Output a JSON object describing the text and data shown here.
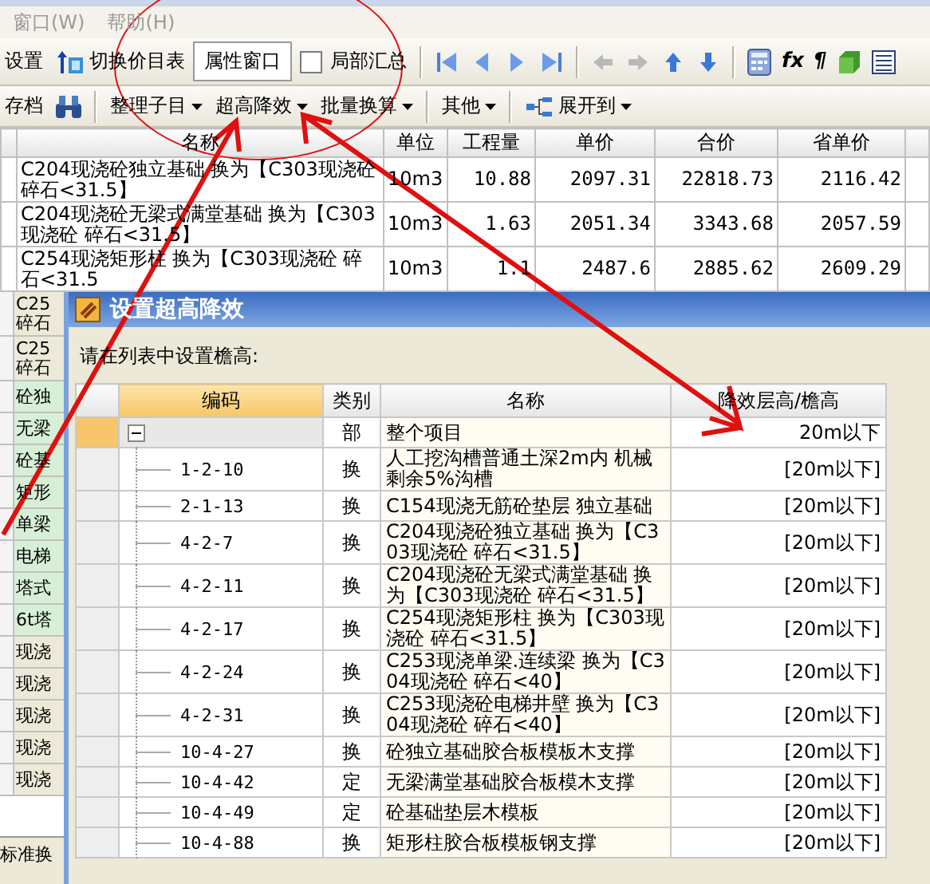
{
  "menu": [
    {
      "label": "窗口(W)",
      "disabled": true
    },
    {
      "label": "帮助(H)",
      "disabled": true
    }
  ],
  "toolbar": {
    "items": [
      {
        "kind": "button",
        "label": "设置"
      },
      {
        "kind": "icon-button",
        "label": "切换价目表"
      },
      {
        "kind": "toggle",
        "label": "属性窗口",
        "selected": true
      },
      {
        "kind": "checkbox",
        "label": "局部汇总",
        "checked": false
      }
    ],
    "glyphs": [
      "fx",
      "¶"
    ]
  },
  "toolbar2": {
    "items": [
      {
        "kind": "button",
        "label": "存档",
        "separator_before": false
      },
      {
        "kind": "search",
        "separator_before": false
      },
      {
        "kind": "menu",
        "label": "整理子目",
        "separator_before": true
      },
      {
        "kind": "menu",
        "label": "超高降效",
        "separator_before": false
      },
      {
        "kind": "menu",
        "label": "批量换算",
        "separator_before": false
      },
      {
        "kind": "menu",
        "label": "其他",
        "separator_before": true
      },
      {
        "kind": "icon-menu",
        "label": "展开到",
        "separator_before": true
      }
    ]
  },
  "table": {
    "columns": [
      "名称",
      "单位",
      "工程量",
      "单价",
      "合价",
      "省单价"
    ],
    "rows": [
      [
        "C204现浇砼独立基础 换为【C303现浇砼碎石<31.5】",
        "10m3",
        "10.88",
        "2097.31",
        "22818.73",
        "2116.42"
      ],
      [
        "C204现浇砼无梁式满堂基础 换为【C303现浇砼 碎石<31.5】",
        "10m3",
        "1.63",
        "2051.34",
        "3343.68",
        "2057.59"
      ],
      [
        "C254现浇矩形柱 换为【C303现浇砼 碎石<31.5",
        "10m3",
        "1.1",
        "2487.6",
        "2885.62",
        "2609.29"
      ]
    ],
    "hidden_rows": [
      {
        "lines": [
          "C25",
          "碎石"
        ],
        "highlighted": false
      },
      {
        "lines": [
          "C25",
          "碎石"
        ],
        "highlighted": false
      },
      {
        "lines": [
          "砼独"
        ],
        "highlighted": true
      },
      {
        "lines": [
          "无梁"
        ],
        "highlighted": true
      },
      {
        "lines": [
          "砼基"
        ],
        "highlighted": true
      },
      {
        "lines": [
          "矩形"
        ],
        "highlighted": true
      },
      {
        "lines": [
          "单梁"
        ],
        "highlighted": true
      },
      {
        "lines": [
          "电梯"
        ],
        "highlighted": true
      },
      {
        "lines": [
          "塔式"
        ],
        "highlighted": true
      },
      {
        "lines": [
          "6t塔"
        ],
        "highlighted": true
      },
      {
        "lines": [
          "现浇"
        ],
        "highlighted": false
      },
      {
        "lines": [
          "现浇"
        ],
        "highlighted": false
      },
      {
        "lines": [
          "现浇"
        ],
        "highlighted": false
      },
      {
        "lines": [
          "现浇"
        ],
        "highlighted": false
      },
      {
        "lines": [
          "现浇"
        ],
        "highlighted": false
      }
    ],
    "bottom_tab": "标准换"
  },
  "dialog": {
    "title": "设置超高降效",
    "prompt": "请在列表中设置檐高:",
    "columns": [
      "编码",
      "类别",
      "名称",
      "降效层高/檐高"
    ],
    "root": {
      "type": "部",
      "name": "整个项目",
      "height": "20m以下",
      "expanded": true,
      "selected": true,
      "children": [
        {
          "code": "1-2-10",
          "type": "换",
          "name": "人工挖沟槽普通土深2m内 机械剩余5%沟槽",
          "height": "[20m以下]",
          "selected": false
        },
        {
          "code": "2-1-13",
          "type": "换",
          "name": "C154现浇无筋砼垫层 独立基础",
          "height": "[20m以下]",
          "selected": false
        },
        {
          "code": "4-2-7",
          "type": "换",
          "name": "C204现浇砼独立基础 换为【C303现浇砼 碎石<31.5】",
          "height": "[20m以下]",
          "selected": false
        },
        {
          "code": "4-2-11",
          "type": "换",
          "name": "C204现浇砼无梁式满堂基础 换为【C303现浇砼 碎石<31.5】",
          "height": "[20m以下]",
          "selected": false
        },
        {
          "code": "4-2-17",
          "type": "换",
          "name": "C254现浇矩形柱 换为【C303现浇砼 碎石<31.5】",
          "height": "[20m以下]",
          "selected": false
        },
        {
          "code": "4-2-24",
          "type": "换",
          "name": "C253现浇单梁.连续梁 换为【C304现浇砼 碎石<40】",
          "height": "[20m以下]",
          "selected": false
        },
        {
          "code": "4-2-31",
          "type": "换",
          "name": "C253现浇砼电梯井壁 换为【C304现浇砼 碎石<40】",
          "height": "[20m以下]",
          "selected": false
        },
        {
          "code": "10-4-27",
          "type": "换",
          "name": "砼独立基础胶合板模板木支撑",
          "height": "[20m以下]",
          "selected": false
        },
        {
          "code": "10-4-42",
          "type": "定",
          "name": "无梁满堂基础胶合板模木支撑",
          "height": "[20m以下]",
          "selected": false
        },
        {
          "code": "10-4-49",
          "type": "定",
          "name": "砼基础垫层木模板",
          "height": "[20m以下]",
          "selected": false
        },
        {
          "code": "10-4-88",
          "type": "换",
          "name": "矩形柱胶合板模板钢支撑",
          "height": "[20m以下]",
          "selected": false
        }
      ]
    }
  }
}
